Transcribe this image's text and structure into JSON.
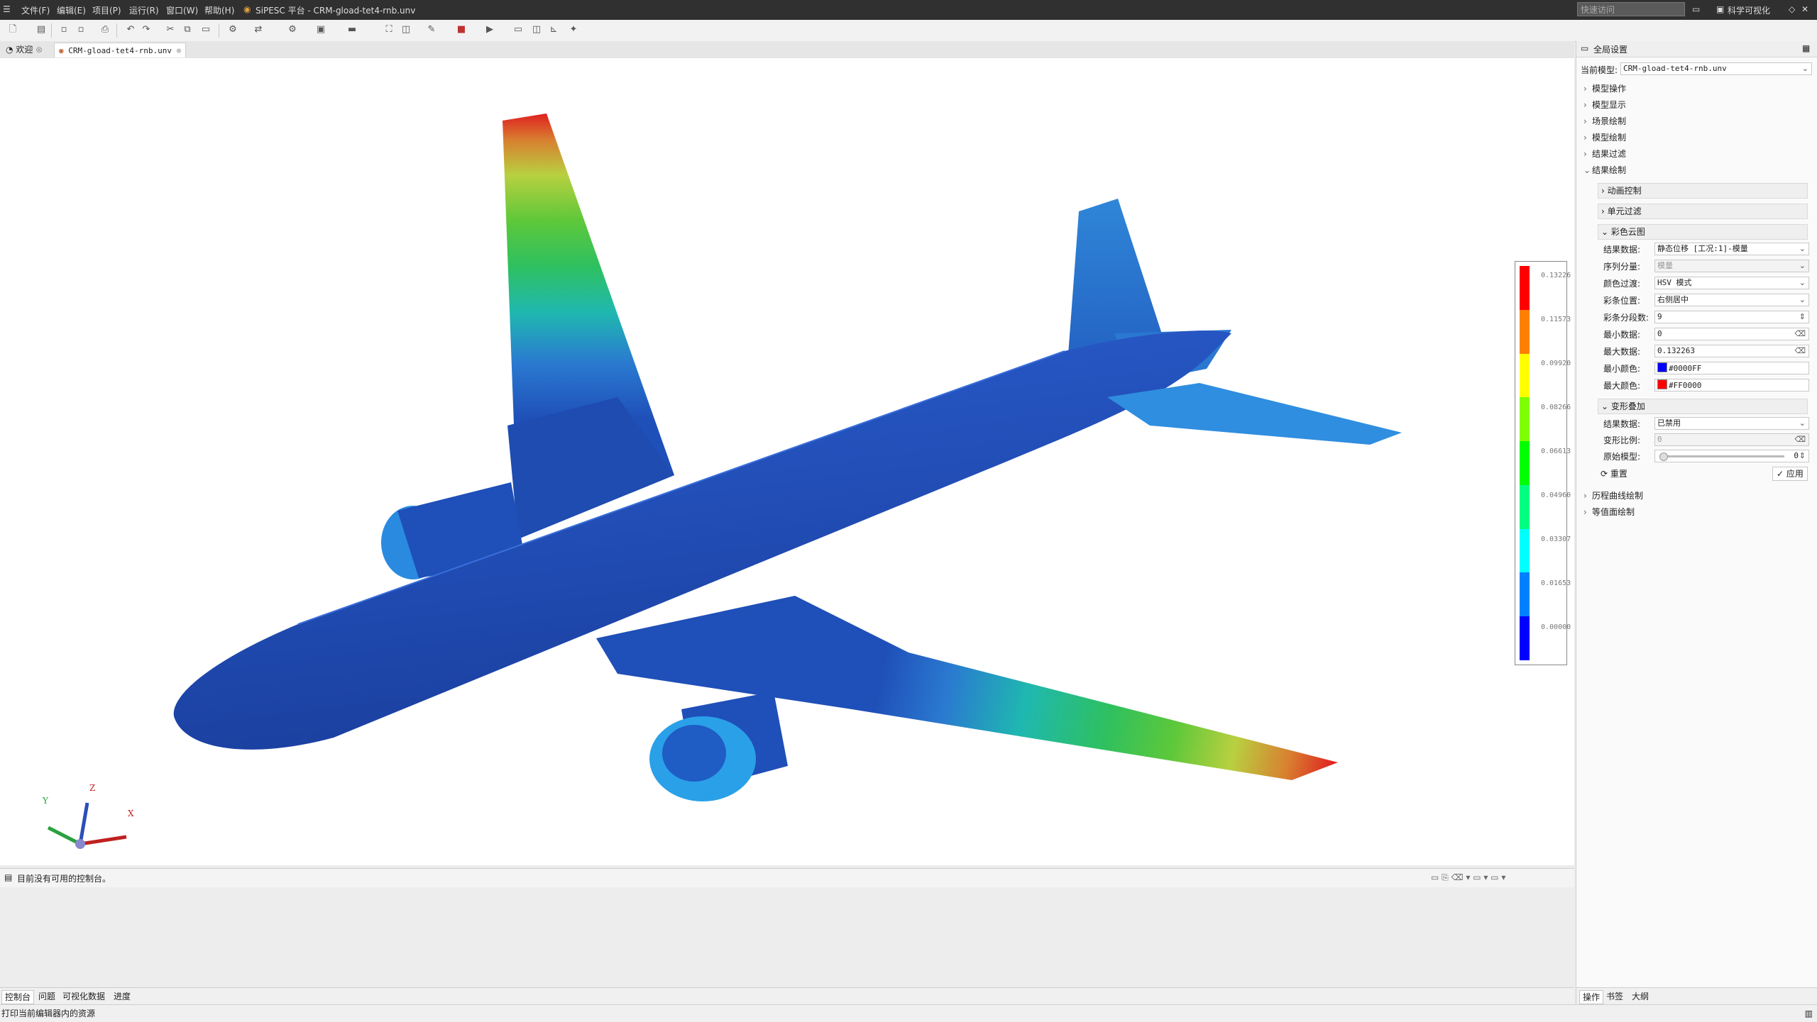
{
  "menubar": {
    "items": [
      "文件(F)",
      "编辑(E)",
      "项目(P)",
      "运行(R)",
      "窗口(W)",
      "帮助(H)"
    ],
    "window_title": "SiPESC 平台 - CRM-gload-tet4-rnb.unv",
    "quick_access_placeholder": "快速访问",
    "perspective": "科学可视化"
  },
  "tabs": [
    {
      "label": "欢迎",
      "active": false
    },
    {
      "label": "CRM-gload-tet4-rnb.unv",
      "active": true
    }
  ],
  "legend": {
    "ticks": [
      "0.13226",
      "0.11573",
      "0.09920",
      "0.08266",
      "0.06613",
      "0.04960",
      "0.03307",
      "0.01653",
      "0.00000"
    ],
    "colors": [
      "#ff0000",
      "#ff8000",
      "#ffff00",
      "#80ff00",
      "#00ff00",
      "#00ff80",
      "#00ffff",
      "#0080ff",
      "#0000ff"
    ]
  },
  "axes": {
    "x": "X",
    "y": "Y",
    "z": "Z"
  },
  "console": {
    "message": "目前没有可用的控制台。"
  },
  "bottom_tabs": [
    "控制台",
    "问题",
    "可视化数据",
    "进度"
  ],
  "status": "打印当前编辑器内的资源",
  "panel": {
    "title": "全局设置",
    "current_model_label": "当前模型:",
    "current_model": "CRM-gload-tet4-rnb.unv",
    "tree": [
      "模型操作",
      "模型显示",
      "场景绘制",
      "模型绘制",
      "结果过滤",
      "结果绘制"
    ],
    "groups": {
      "anim": "动画控制",
      "elem": "单元过滤",
      "contour": "彩色云图",
      "deform": "变形叠加"
    },
    "contour_fields": [
      {
        "label": "结果数据:",
        "value": "静态位移 [工况:1]-模量",
        "type": "select"
      },
      {
        "label": "序列分量:",
        "value": "模量",
        "type": "select-disabled"
      },
      {
        "label": "颜色过渡:",
        "value": "HSV 模式",
        "type": "select"
      },
      {
        "label": "彩条位置:",
        "value": "右侧居中",
        "type": "select"
      },
      {
        "label": "彩条分段数:",
        "value": "9",
        "type": "spin"
      },
      {
        "label": "最小数据:",
        "value": "0",
        "type": "clear"
      },
      {
        "label": "最大数据:",
        "value": "0.132263",
        "type": "clear"
      },
      {
        "label": "最小颜色:",
        "value": "#0000FF",
        "type": "color"
      },
      {
        "label": "最大颜色:",
        "value": "#FF0000",
        "type": "color"
      }
    ],
    "deform_fields": [
      {
        "label": "结果数据:",
        "value": "已禁用",
        "type": "select"
      },
      {
        "label": "变形比例:",
        "value": "0",
        "type": "clear-disabled"
      },
      {
        "label": "原始模型:",
        "value": "0",
        "type": "slider"
      }
    ],
    "reset_label": "重置",
    "apply_label": "应用",
    "tree_after": [
      "历程曲线绘制",
      "等值面绘制"
    ],
    "tabs": [
      "操作",
      "书签",
      "大纲"
    ]
  }
}
